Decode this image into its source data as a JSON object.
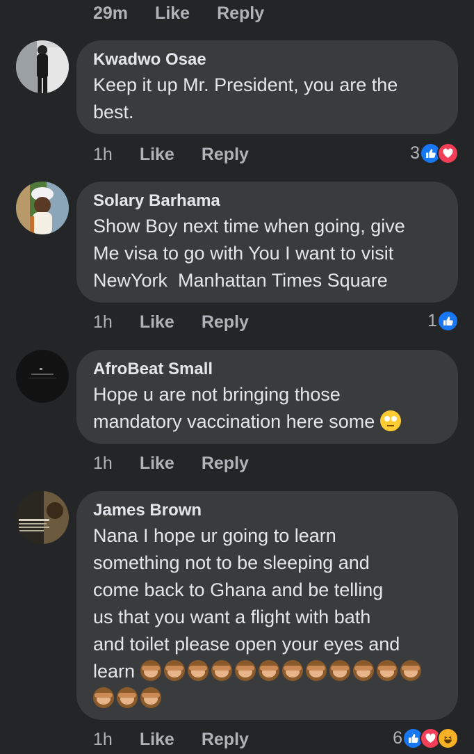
{
  "top_actions": {
    "time": "29m",
    "like": "Like",
    "reply": "Reply"
  },
  "comments": [
    {
      "author": "Kwadwo Osae",
      "text": "Keep it up Mr. President, you are the\nbest.",
      "time": "1h",
      "like": "Like",
      "reply": "Reply",
      "reaction_count": "3",
      "reactions": [
        "like-icon",
        "love-icon"
      ]
    },
    {
      "author": "Solary Barhama",
      "text": "Show Boy next time when going, give\nMe visa to go with You I want to visit\nNewYork  Manhattan Times Square",
      "time": "1h",
      "like": "Like",
      "reply": "Reply",
      "reaction_count": "1",
      "reactions": [
        "like-icon"
      ]
    },
    {
      "author": "AfroBeat Small",
      "text": "Hope u are not bringing those\nmandatory vaccination here some",
      "text_emoji": "face-with-rolling-eyes-emoji",
      "time": "1h",
      "like": "Like",
      "reply": "Reply"
    },
    {
      "author": "James Brown",
      "text": "Nana I hope ur going to learn\nsomething not to be sleeping and\ncome back to Ghana and be telling\nus that you want a flight with bath\nand toilet please open your eyes and\nlearn",
      "text_emoji": "see-no-evil-monkey-emoji",
      "text_emoji_count": 15,
      "time": "1h",
      "like": "Like",
      "reply": "Reply",
      "reaction_count": "6",
      "reactions": [
        "like-icon",
        "love-icon",
        "haha-icon"
      ]
    }
  ],
  "colors": {
    "background": "#242526",
    "bubble": "#3a3b3c",
    "primary_text": "#e4e6eb",
    "secondary_text": "#b0b3b8",
    "like_blue": "#1877f2",
    "love_red": "#f33e58",
    "haha_yellow": "#f7b125"
  }
}
